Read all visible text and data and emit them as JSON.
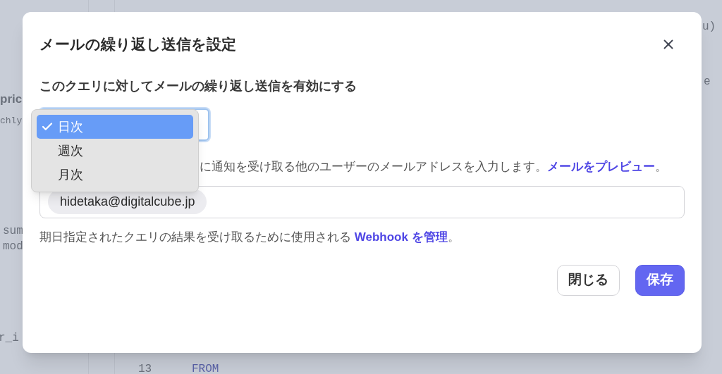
{
  "background_code": [
    {
      "text": "pric",
      "kind": "label"
    },
    {
      "text": "chly",
      "kind": "code"
    },
    {
      "text": "sum",
      "kind": "code"
    },
    {
      "text": "mod",
      "kind": "code"
    },
    {
      "text": "r_i",
      "kind": "code"
    },
    {
      "text": "13",
      "kind": "line_number"
    },
    {
      "text": "FROM",
      "kind": "keyword"
    },
    {
      "text": "u)",
      "kind": "code"
    },
    {
      "text": "e",
      "kind": "code"
    }
  ],
  "dialog": {
    "title": "メールの繰り返し送信を設定",
    "enable_label": "このクエリに対してメールの繰り返し送信を有効にする",
    "frequency_options": [
      {
        "label": "日次",
        "selected": true
      },
      {
        "label": "週次",
        "selected": false
      },
      {
        "label": "月次",
        "selected": false
      }
    ],
    "recipients_text": "に通知を受け取る他のユーザーのメールアドレスを入力します。",
    "preview_link": "メールをプレビュー",
    "recipients_text_end": "。",
    "recipients": [
      "hidetaka@digitalcube.jp"
    ],
    "webhook_text": "期日指定されたクエリの結果を受け取るために使用される ",
    "webhook_link": "Webhook を管理",
    "webhook_text_end": "。",
    "buttons": [
      {
        "label": "閉じる",
        "kind": "secondary"
      },
      {
        "label": "保存",
        "kind": "primary"
      }
    ]
  }
}
